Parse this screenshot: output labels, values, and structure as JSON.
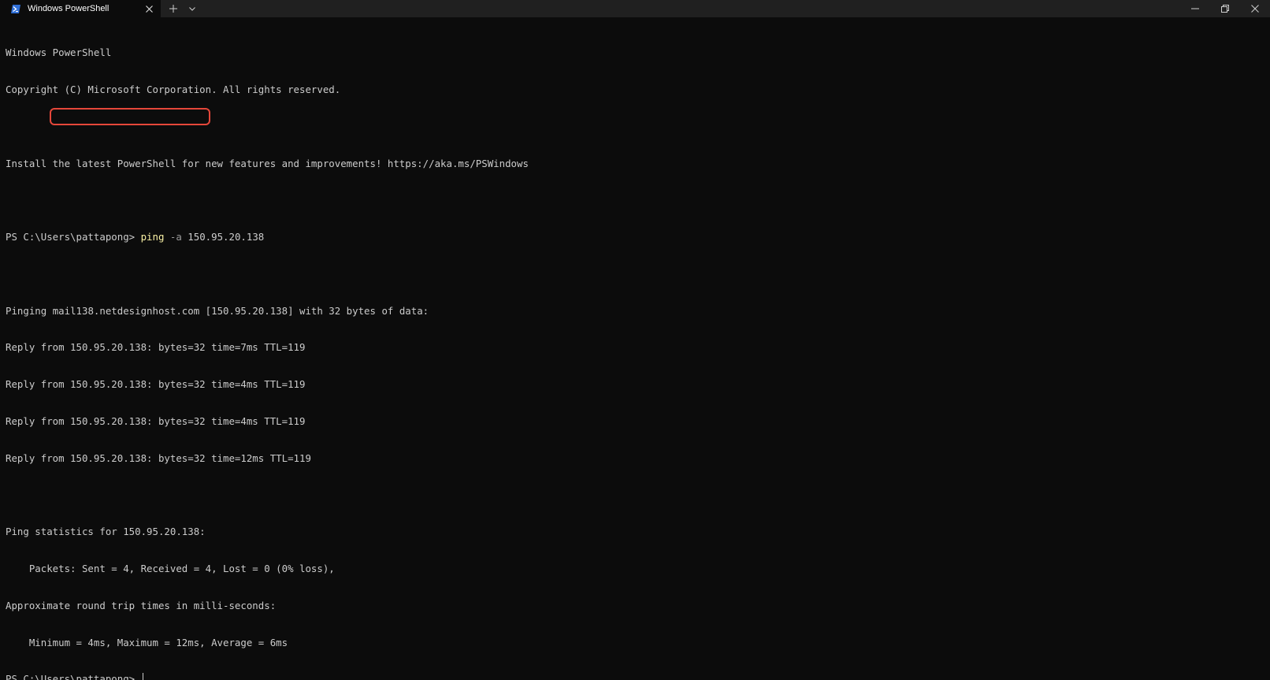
{
  "window": {
    "tab_title": "Windows PowerShell",
    "tab_icon": "powershell-icon",
    "controls": [
      "minimize-icon",
      "restore-icon",
      "close-icon"
    ],
    "colors": {
      "titlebar": "#202020",
      "background": "#0c0c0c",
      "text": "#cccccc",
      "command": "#f9f1a5",
      "parameter": "#9a9a9a",
      "highlight": "#e5473a"
    }
  },
  "terminal": {
    "banner_1": "Windows PowerShell",
    "banner_2": "Copyright (C) Microsoft Corporation. All rights reserved.",
    "install_note": "Install the latest PowerShell for new features and improvements! https://aka.ms/PSWindows",
    "prompt": "PS C:\\Users\\pattapong> ",
    "command": "ping",
    "param": "-a",
    "argument": "150.95.20.138",
    "pinging_prefix": "Pinging ",
    "hostname": "mail138.netdesignhost.com",
    "pinging_suffix": " [150.95.20.138] with 32 bytes of data:",
    "replies": [
      "Reply from 150.95.20.138: bytes=32 time=7ms TTL=119",
      "Reply from 150.95.20.138: bytes=32 time=4ms TTL=119",
      "Reply from 150.95.20.138: bytes=32 time=4ms TTL=119",
      "Reply from 150.95.20.138: bytes=32 time=12ms TTL=119"
    ],
    "stats_header": "Ping statistics for 150.95.20.138:",
    "stats_packets": "    Packets: Sent = 4, Received = 4, Lost = 0 (0% loss),",
    "rtt_header": "Approximate round trip times in milli-seconds:",
    "rtt_values": "    Minimum = 4ms, Maximum = 12ms, Average = 6ms",
    "final_prompt": "PS C:\\Users\\pattapong> "
  }
}
